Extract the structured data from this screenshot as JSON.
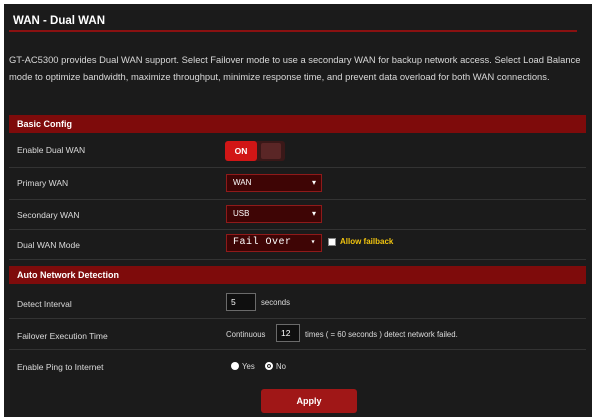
{
  "page": {
    "title": "WAN - Dual WAN",
    "description": "GT-AC5300 provides Dual WAN support. Select Failover mode to use a secondary WAN for backup network access. Select Load Balance mode to optimize bandwidth, maximize throughput, minimize response time, and prevent data overload for both WAN connections."
  },
  "basic_config": {
    "header": "Basic Config",
    "enable_dual_wan": {
      "label": "Enable Dual WAN",
      "state": "ON"
    },
    "primary_wan": {
      "label": "Primary WAN",
      "value": "WAN"
    },
    "secondary_wan": {
      "label": "Secondary WAN",
      "value": "USB"
    },
    "dual_wan_mode": {
      "label": "Dual WAN Mode",
      "value": "Fail Over",
      "allow_failback_label": "Allow failback"
    }
  },
  "auto_detection": {
    "header": "Auto Network Detection",
    "detect_interval": {
      "label": "Detect Interval",
      "value": "5",
      "unit": "seconds"
    },
    "failover_execution_time": {
      "label": "Failover Execution Time",
      "prefix": "Continuous",
      "value": "12",
      "suffix": "times ( = 60 seconds ) detect network failed."
    },
    "enable_ping": {
      "label": "Enable Ping to Internet",
      "yes_label": "Yes",
      "no_label": "No",
      "selected": "No"
    }
  },
  "apply_label": "Apply"
}
